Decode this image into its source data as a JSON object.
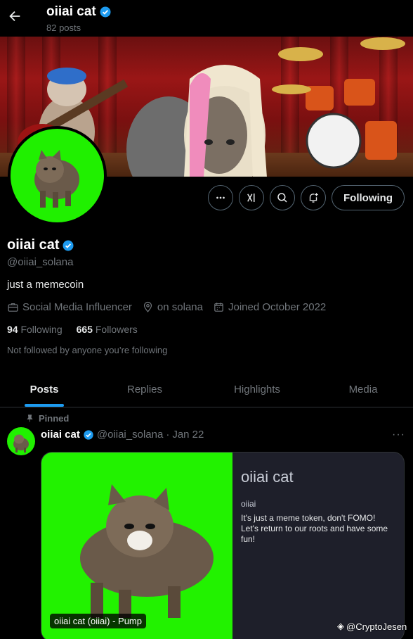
{
  "header": {
    "title": "oiiai cat",
    "posts_count": "82 posts"
  },
  "actions": {
    "more": "more-options",
    "grok": "grok-icon",
    "search": "search-icon",
    "notify": "notify-icon",
    "follow_label": "Following"
  },
  "profile": {
    "name": "oiiai cat",
    "handle": "@oiiai_solana",
    "bio": "just a memecoin",
    "category": "Social Media Influencer",
    "location": "on solana",
    "joined": "Joined October 2022",
    "following_count": "94",
    "following_label": "Following",
    "followers_count": "665",
    "followers_label": "Followers",
    "not_followed": "Not followed by anyone you’re following"
  },
  "tabs": [
    {
      "label": "Posts"
    },
    {
      "label": "Replies"
    },
    {
      "label": "Highlights"
    },
    {
      "label": "Media"
    }
  ],
  "post": {
    "pinned_label": "Pinned",
    "name": "oiiai cat",
    "handle": "@oiiai_solana",
    "separator": "·",
    "date": "Jan 22",
    "card": {
      "image_tag": "oiiai cat (oiiai) - Pump",
      "title": "oiiai cat",
      "ticker": "oiiai",
      "description": "It's just a meme token, don't FOMO! Let's return to our roots and have some fun!"
    }
  },
  "watermark": "@CryptoJesen",
  "colors": {
    "accent": "#1d9bf0",
    "green_screen": "#20f000",
    "muted": "#71767b",
    "card_bg": "#1e1f2a"
  }
}
